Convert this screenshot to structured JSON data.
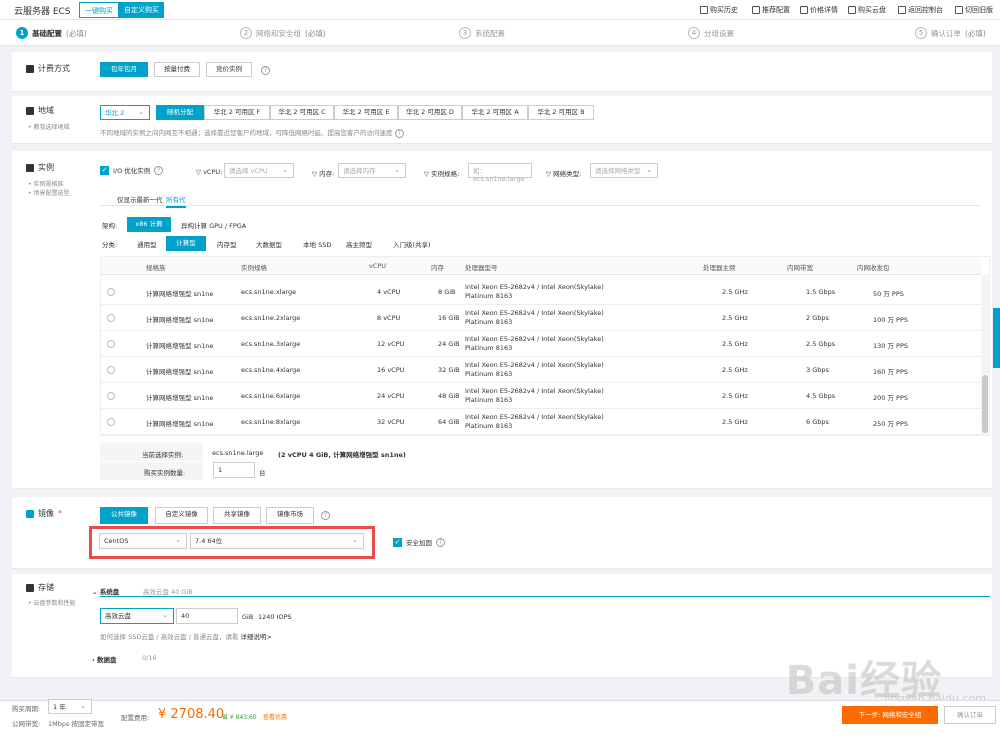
{
  "header": {
    "brand": "云服务器 ECS",
    "tab_quick": "一键购买",
    "tab_custom": "自定义购买",
    "nav": [
      "购买历史",
      "推荐配置",
      "价格详情",
      "购买云盘",
      "返回控制台",
      "切回旧版"
    ]
  },
  "steps": [
    {
      "num": "1",
      "label": "基础配置",
      "note": "(必填)"
    },
    {
      "num": "2",
      "label": "网络和安全组",
      "note": "(必填)"
    },
    {
      "num": "3",
      "label": "系统配置",
      "note": ""
    },
    {
      "num": "4",
      "label": "分组设置",
      "note": ""
    },
    {
      "num": "5",
      "label": "确认订单",
      "note": "(必填)"
    }
  ],
  "billing": {
    "title": "计费方式",
    "options": [
      "包年包月",
      "按量付费",
      "竞价实例"
    ]
  },
  "region": {
    "title": "地域",
    "sub": "• 教我选择地域",
    "selected": "华北 2",
    "zones": [
      "随机分配",
      "华北 2 可用区 F",
      "华北 2 可用区 C",
      "华北 2 可用区 E",
      "华北 2 可用区 D",
      "华北 2 可用区 A",
      "华北 2 可用区 B"
    ],
    "hint": "不同地域的实例之间内网互不相通；选择靠近您客户的地域，可降低网络时延、提高您客户的访问速度"
  },
  "instance": {
    "title": "实例",
    "subs": [
      "• 实例规格族",
      "• 场景配置选型"
    ],
    "io": "I/O 优化实例",
    "filters": [
      {
        "label": "vCPU:",
        "placeholder": "请选择 vCPU"
      },
      {
        "label": "内存:",
        "placeholder": "请选择内存"
      },
      {
        "label": "实例规格:",
        "placeholder": "如：ecs.sn1ne.large"
      },
      {
        "label": "网络类型:",
        "placeholder": "请选择网络类型"
      }
    ],
    "gen_tabs": [
      "仅显示最新一代",
      "所有代"
    ],
    "arch_label": "架构:",
    "arch": [
      "x86 计算",
      "异构计算 GPU / FPGA"
    ],
    "cat_label": "分类:",
    "cats": [
      "通用型",
      "计算型",
      "内存型",
      "大数据型",
      "本地 SSD",
      "高主频型",
      "入门级(共享)"
    ],
    "columns": [
      "规格族",
      "实例规格",
      "vCPU",
      "内存",
      "处理器型号",
      "处理器主频",
      "内网带宽",
      "内网收发包"
    ],
    "rows": [
      {
        "family": "计算网络增强型 sn1ne",
        "spec": "ecs.sn1ne.xlarge",
        "vcpu": "4 vCPU",
        "mem": "8 GiB",
        "cpu1": "Intel Xeon E5-2682v4 / Intel Xeon(Skylake)",
        "cpu2": "Platinum 8163",
        "freq": "2.5 GHz",
        "bw": "1.5 Gbps",
        "pps": "50 万 PPS"
      },
      {
        "family": "计算网络增强型 sn1ne",
        "spec": "ecs.sn1ne.2xlarge",
        "vcpu": "8 vCPU",
        "mem": "16 GiB",
        "cpu1": "Intel Xeon E5-2682v4 / Intel Xeon(Skylake)",
        "cpu2": "Platinum 8163",
        "freq": "2.5 GHz",
        "bw": "2 Gbps",
        "pps": "100 万 PPS"
      },
      {
        "family": "计算网络增强型 sn1ne",
        "spec": "ecs.sn1ne.3xlarge",
        "vcpu": "12 vCPU",
        "mem": "24 GiB",
        "cpu1": "Intel Xeon E5-2682v4 / Intel Xeon(Skylake)",
        "cpu2": "Platinum 8163",
        "freq": "2.5 GHz",
        "bw": "2.5 Gbps",
        "pps": "130 万 PPS"
      },
      {
        "family": "计算网络增强型 sn1ne",
        "spec": "ecs.sn1ne.4xlarge",
        "vcpu": "16 vCPU",
        "mem": "32 GiB",
        "cpu1": "Intel Xeon E5-2682v4 / Intel Xeon(Skylake)",
        "cpu2": "Platinum 8163",
        "freq": "2.5 GHz",
        "bw": "3 Gbps",
        "pps": "160 万 PPS"
      },
      {
        "family": "计算网络增强型 sn1ne",
        "spec": "ecs.sn1ne.6xlarge",
        "vcpu": "24 vCPU",
        "mem": "48 GiB",
        "cpu1": "Intel Xeon E5-2682v4 / Intel Xeon(Skylake)",
        "cpu2": "Platinum 8163",
        "freq": "2.5 GHz",
        "bw": "4.5 Gbps",
        "pps": "200 万 PPS"
      },
      {
        "family": "计算网络增强型 sn1ne",
        "spec": "ecs.sn1ne.8xlarge",
        "vcpu": "32 vCPU",
        "mem": "64 GiB",
        "cpu1": "Intel Xeon E5-2682v4 / Intel Xeon(Skylake)",
        "cpu2": "Platinum 8163",
        "freq": "2.5 GHz",
        "bw": "6 Gbps",
        "pps": "250 万 PPS"
      }
    ],
    "current_label": "当前选择实例:",
    "current_spec": "ecs.sn1ne.large",
    "current_desc": "(2 vCPU 4 GiB, 计算网络增强型 sn1ne)",
    "qty_label": "购买实例数量:",
    "qty": "1",
    "qty_unit": "台"
  },
  "image": {
    "title": "镜像",
    "tabs": [
      "公共镜像",
      "自定义镜像",
      "共享镜像",
      "镜像市场"
    ],
    "os": "CentOS",
    "version": "7.4 64位",
    "secure": "安全加固"
  },
  "storage": {
    "title": "存储",
    "sub": "• 云盘参数和性能",
    "system_disk": "系统盘",
    "system_summary": "高效云盘 40 GiB",
    "disk_type": "高效云盘",
    "size": "40",
    "unit": "GiB",
    "iops": "1240 IOPS",
    "hint": "如何选择 SSD云盘 / 高效云盘 / 普通云盘，请看",
    "hint_link": "详细说明>",
    "data_disk": "数据盘",
    "data_count": "0/16"
  },
  "footer": {
    "period_label": "购买周期:",
    "period": "1 年",
    "bw_label": "公网带宽:",
    "bw": "1Mbps 按固定带宽",
    "cost_label": "配置费用:",
    "price": "¥ 2708.40",
    "save": "省 ¥ 843.60",
    "detail": "查看优惠",
    "next": "下一步: 网络和安全组",
    "confirm": "确认订单"
  },
  "watermark": {
    "baidu": "Bai经验",
    "url": "jingyan.baidu.com"
  }
}
